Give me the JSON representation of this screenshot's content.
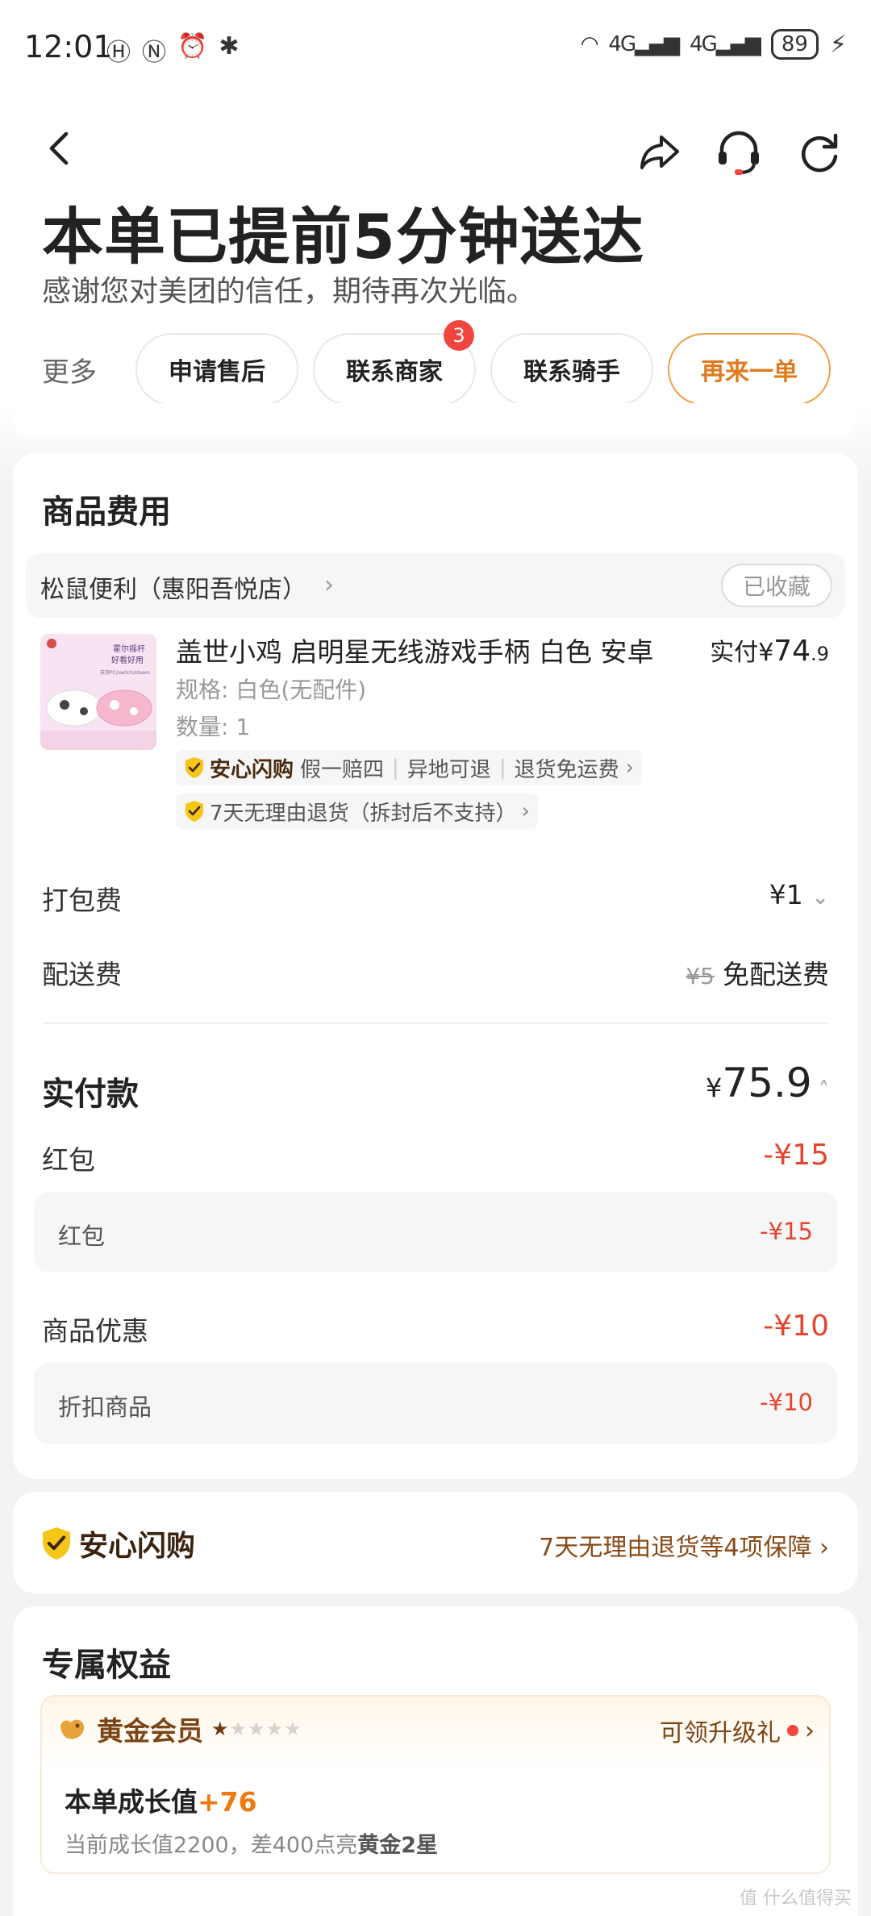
{
  "status_bar": {
    "time": "12:01",
    "battery": "89",
    "network1": "4G",
    "network2": "4G"
  },
  "header": {
    "title": "本单已提前5分钟送达",
    "subtitle": "感谢您对美团的信任，期待再次光临。"
  },
  "actions": {
    "more": "更多",
    "after_sale": "申请售后",
    "contact_merchant": "联系商家",
    "merchant_badge": "3",
    "contact_rider": "联系骑手",
    "reorder": "再来一单"
  },
  "goods": {
    "section_title": "商品费用",
    "store_name": "松鼠便利（惠阳吾悦店）",
    "favorite": "已收藏",
    "product": {
      "name": "盖世小鸡 启明星无线游戏手柄 白色 安卓",
      "paid_label": "实付",
      "price_yen": "¥",
      "price_main": "74",
      "price_decimal": ".9",
      "spec": "规格: 白色(无配件)",
      "quantity": "数量: 1",
      "image_text_1": "霍尔摇杆",
      "image_text_2": "好看好用",
      "image_text_3": "支持PC/switch/steam"
    },
    "tags": {
      "assure_name": "安心闪购",
      "tag1": "假一赔四",
      "tag2": "异地可退",
      "tag3": "退货免运费",
      "return_policy": "7天无理由退货（拆封后不支持）"
    },
    "packing_fee_label": "打包费",
    "packing_fee": "¥1",
    "delivery_fee_label": "配送费",
    "delivery_fee_original": "¥5",
    "delivery_fee": "免配送费",
    "total_label": "实付款",
    "total_yen": "¥",
    "total": "75.9",
    "redpacket_label": "红包",
    "redpacket_value": "-¥15",
    "redpacket_sub_label": "红包",
    "redpacket_sub_value": "-¥15",
    "discount_label": "商品优惠",
    "discount_value": "-¥10",
    "discount_sub_label": "折扣商品",
    "discount_sub_value": "-¥10"
  },
  "assurance": {
    "name": "安心闪购",
    "detail": "7天无理由退货等4项保障"
  },
  "rights": {
    "section_title": "专属权益",
    "member_level": "黄金会员",
    "stars_filled": 1,
    "stars_total": 5,
    "gift": "可领升级礼",
    "growth_label": "本单成长值",
    "growth_value": "+76",
    "growth_desc_prefix": "当前成长值2200，差400点亮",
    "growth_desc_target": "黄金2星"
  },
  "watermark": "值 什么值得买",
  "colors": {
    "accent": "#e07b1d",
    "discount": "#e5452e",
    "badge": "#f2453d",
    "assure_gold": "#f5c518"
  }
}
